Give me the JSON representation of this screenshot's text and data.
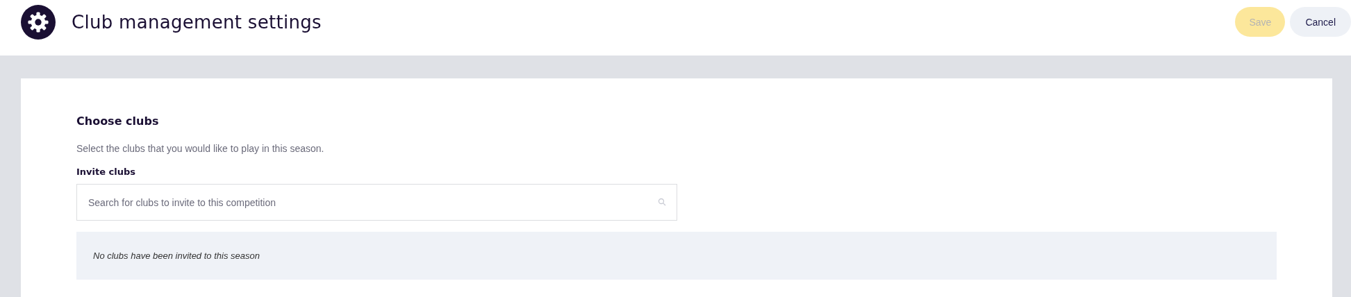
{
  "header": {
    "title": "Club management settings"
  },
  "buttons": [
    {
      "label": "Save",
      "kind": "primary",
      "disabled": true
    },
    {
      "label": "Cancel",
      "kind": "secondary",
      "disabled": false
    }
  ],
  "section": {
    "title": "Choose clubs",
    "description": "Select the clubs that you would like to play in this season.",
    "field_label": "Invite clubs",
    "search": {
      "placeholder": "Search for clubs to invite to this competition"
    },
    "empty_message": "No clubs have been invited to this season"
  }
}
